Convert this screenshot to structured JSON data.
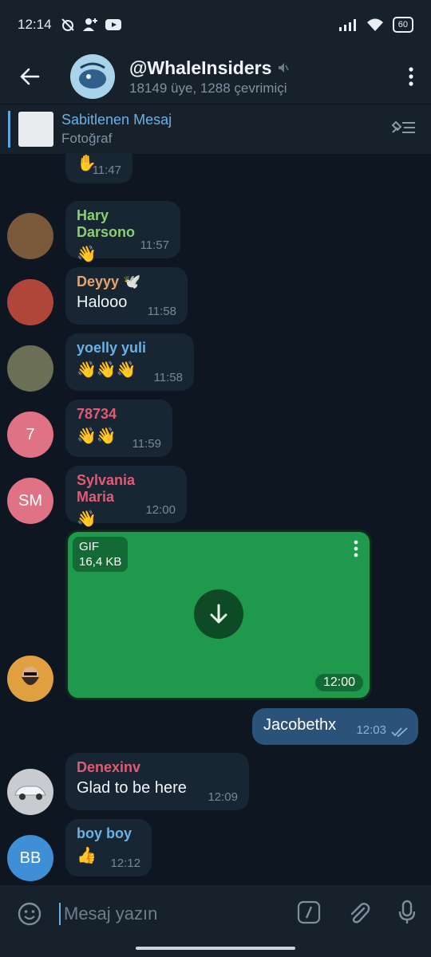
{
  "statusbar": {
    "time": "12:14",
    "battery": "60"
  },
  "header": {
    "title": "@WhaleInsiders",
    "subtitle": "18149 üye, 1288 çevrimiçi"
  },
  "pinned": {
    "title": "Sabitlenen Mesaj",
    "subtitle": "Fotoğraf"
  },
  "messages": [
    {
      "name": "",
      "text": "✋",
      "time": "11:47",
      "avatar_color": "#d98a3c"
    },
    {
      "name": "Hary Darsono",
      "text": "👋",
      "time": "11:57",
      "name_color": "#8bd06f",
      "avatar_color": "#7a5a3a"
    },
    {
      "name": "Deyyy 🕊️",
      "text": "Halooo",
      "time": "11:58",
      "name_color": "#e8a36a",
      "avatar_color": "#b0463a"
    },
    {
      "name": "yoelly yuli",
      "text": "👋👋👋",
      "time": "11:58",
      "name_color": "#6ab2e6",
      "avatar_color": "#6b6f55"
    },
    {
      "name": "78734",
      "text": "👋👋",
      "time": "11:59",
      "name_color": "#e25a74",
      "avatar_initials": "7",
      "avatar_color": "#e07286"
    },
    {
      "name": "Sylvania Maria",
      "text": "👋",
      "time": "12:00",
      "name_color": "#e25a74",
      "avatar_initials": "SM",
      "avatar_color": "#e07286"
    },
    {
      "name": "Denexinv",
      "text": "Glad to be here",
      "time": "12:09",
      "name_color": "#e25a74",
      "avatar_color": "#c8ccd0"
    },
    {
      "name": "boy boy",
      "text": "👍",
      "time": "12:12",
      "name_color": "#6ab2e6",
      "avatar_initials": "BB",
      "avatar_color": "#3f8fd6"
    }
  ],
  "gif": {
    "label": "GIF",
    "size": "16,4 KB",
    "time": "12:00",
    "color": "#1f9a4d"
  },
  "outgoing": {
    "text": "Jacobethx",
    "time": "12:03"
  },
  "composer": {
    "placeholder": "Mesaj yazın"
  }
}
